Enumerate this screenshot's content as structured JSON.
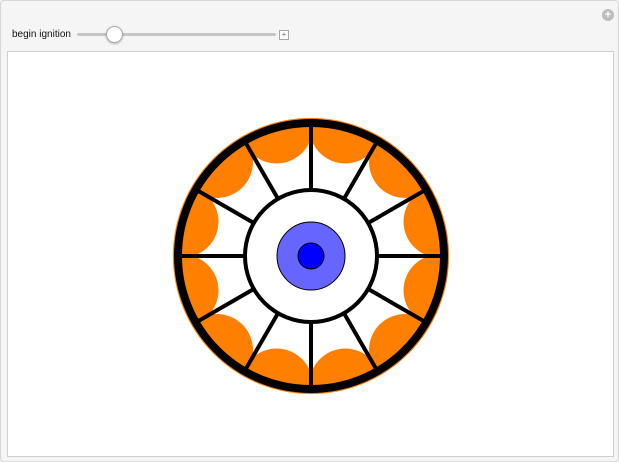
{
  "controls": {
    "slider_label": "begin ignition",
    "slider_value_fraction": 0.16,
    "plus_icon": "plus-icon",
    "corner_icon": "options-icon"
  },
  "figure": {
    "spoke_count": 12,
    "orange_lobe_count": 12,
    "colors": {
      "orange": "#ff8000",
      "outer_ring": "#000000",
      "spokes": "#000000",
      "light_blue": "#6666ff",
      "dark_blue": "#0000ff",
      "background": "#ffffff"
    }
  }
}
